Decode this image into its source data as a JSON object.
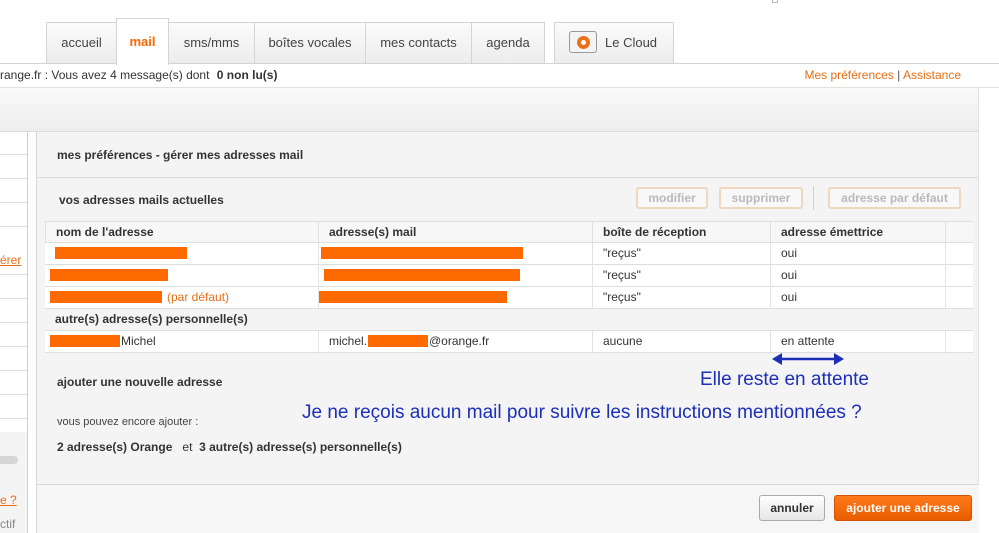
{
  "tabs": [
    {
      "label": "accueil"
    },
    {
      "label": "mail"
    },
    {
      "label": "sms/mms"
    },
    {
      "label": "boîtes vocales"
    },
    {
      "label": "mes contacts"
    },
    {
      "label": "agenda"
    },
    {
      "label": "Le Cloud"
    }
  ],
  "status": {
    "message_prefix": "range.fr : Vous avez  4 message(s) dont ",
    "message_bold": "0 non lu(s)",
    "link_prefs": "Mes préférences",
    "separator": "|",
    "link_help": "Assistance"
  },
  "sidebar": {
    "gerer": "érer",
    "help": "e ?",
    "actif": "ctif"
  },
  "panel": {
    "title": "mes préférences - gérer mes adresses mail",
    "section_title": "vos adresses mails actuelles",
    "btn_modify": "modifier",
    "btn_delete": "supprimer",
    "btn_default": "adresse par défaut"
  },
  "table": {
    "headers": [
      "nom de l'adresse",
      "adresse(s) mail",
      "boîte de réception",
      "adresse émettrice"
    ],
    "rows": [
      {
        "name": "",
        "email": "",
        "inbox": "\"reçus\"",
        "sender": "oui"
      },
      {
        "name": "",
        "email": "",
        "inbox": "\"reçus\"",
        "sender": "oui"
      },
      {
        "name_suffix": "(par défaut)",
        "email": "",
        "inbox": "\"reçus\"",
        "sender": "oui"
      }
    ],
    "group_label": "autre(s) adresse(s) personnelle(s)",
    "personal_row": {
      "name_suffix": "Michel",
      "email_prefix": "michel.",
      "email_suffix": "@orange.fr",
      "inbox": "aucune",
      "sender": "en attente"
    }
  },
  "add_section": {
    "title": "ajouter une nouvelle adresse",
    "subtitle": "vous pouvez encore ajouter :",
    "quota_orange": "2 adresse(s) Orange",
    "quota_and": "et",
    "quota_personal": "3 autre(s) adresse(s) personnelle(s)"
  },
  "annotations": {
    "line1": "Elle reste en attente",
    "line2": "Je ne reçois aucun mail pour suivre les instructions mentionnées ?"
  },
  "footer": {
    "cancel": "annuler",
    "add": "ajouter une adresse"
  },
  "colors": {
    "brand_orange": "#ff6600",
    "annotation_blue": "#1c2fb8",
    "redaction": "#ff6a00"
  }
}
